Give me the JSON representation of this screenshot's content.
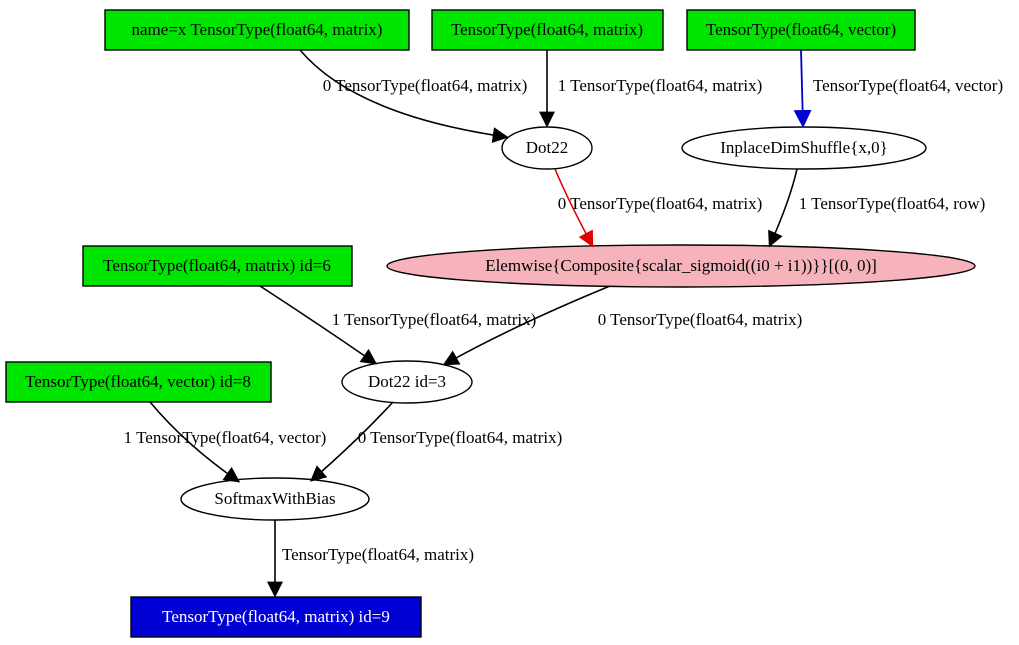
{
  "nodes": {
    "input_x": {
      "label": "name=x TensorType(float64, matrix)",
      "fill": "#00e500",
      "text": "#000"
    },
    "input_w1": {
      "label": "TensorType(float64, matrix)",
      "fill": "#00e500",
      "text": "#000"
    },
    "input_b1": {
      "label": "TensorType(float64, vector)",
      "fill": "#00e500",
      "text": "#000"
    },
    "dot22_a": {
      "label": "Dot22"
    },
    "dimshuffle": {
      "label": "InplaceDimShuffle{x,0}"
    },
    "elemwise": {
      "label": "Elemwise{Composite{scalar_sigmoid((i0 + i1))}}[(0, 0)]",
      "fill": "#f6b3bc"
    },
    "input_w2": {
      "label": "TensorType(float64, matrix) id=6",
      "fill": "#00e500",
      "text": "#000"
    },
    "dot22_b": {
      "label": "Dot22 id=3"
    },
    "input_b2": {
      "label": "TensorType(float64, vector) id=8",
      "fill": "#00e500",
      "text": "#000"
    },
    "softmax": {
      "label": "SoftmaxWithBias"
    },
    "output": {
      "label": "TensorType(float64, matrix) id=9",
      "fill": "#0000d5",
      "text": "#fff"
    }
  },
  "edges": {
    "e_x_dot": {
      "label": "0 TensorType(float64, matrix)"
    },
    "e_w1_dot": {
      "label": "1 TensorType(float64, matrix)"
    },
    "e_b1_dim": {
      "label": "TensorType(float64, vector)"
    },
    "e_dot_elem": {
      "label": "0 TensorType(float64, matrix)"
    },
    "e_dim_elem": {
      "label": "1 TensorType(float64, row)"
    },
    "e_elem_dot2": {
      "label": "0 TensorType(float64, matrix)"
    },
    "e_w2_dot2": {
      "label": "1 TensorType(float64, matrix)"
    },
    "e_dot2_soft": {
      "label": "0 TensorType(float64, matrix)"
    },
    "e_b2_soft": {
      "label": "1 TensorType(float64, vector)"
    },
    "e_soft_out": {
      "label": "TensorType(float64, matrix)"
    }
  },
  "colors": {
    "green": "#00e500",
    "pink": "#f6b3bc",
    "blue": "#0000d5",
    "edge_red": "#e00000",
    "edge_blue": "#0000d0"
  }
}
